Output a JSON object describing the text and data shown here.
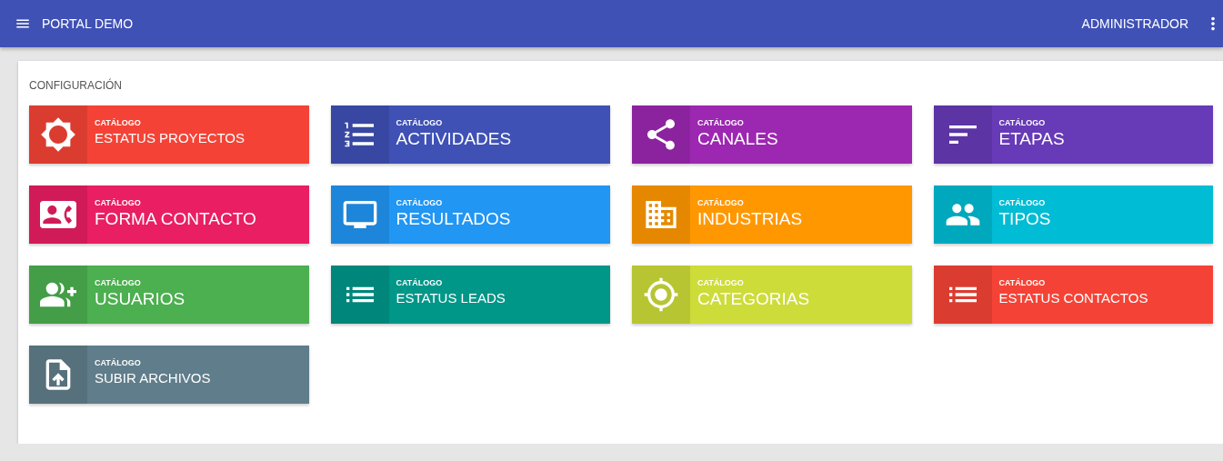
{
  "app_bar": {
    "title": "PORTAL DEMO",
    "user": "ADMINISTRADOR"
  },
  "section": {
    "title": "CONFIGURACIÓN"
  },
  "tiles": [
    {
      "caption": "CATÁLOGO",
      "title": "ESTATUS PROYECTOS",
      "color": "#f44336"
    },
    {
      "caption": "CATÁLOGO",
      "title": "ACTIVIDADES",
      "color": "#3f51b5"
    },
    {
      "caption": "CATÁLOGO",
      "title": "CANALES",
      "color": "#9c27b0"
    },
    {
      "caption": "CATÁLOGO",
      "title": "ETAPAS",
      "color": "#673ab7"
    },
    {
      "caption": "CATÁLOGO",
      "title": "FORMA CONTACTO",
      "color": "#e91e63"
    },
    {
      "caption": "CATÁLOGO",
      "title": "RESULTADOS",
      "color": "#2196f3"
    },
    {
      "caption": "CATÁLOGO",
      "title": "INDUSTRIAS",
      "color": "#ff9800"
    },
    {
      "caption": "CATÁLOGO",
      "title": "TIPOS",
      "color": "#00bcd4"
    },
    {
      "caption": "CATÁLOGO",
      "title": "USUARIOS",
      "color": "#4caf50"
    },
    {
      "caption": "CATÁLOGO",
      "title": "ESTATUS LEADS",
      "color": "#009688"
    },
    {
      "caption": "CATÁLOGO",
      "title": "CATEGORIAS",
      "color": "#cddc39"
    },
    {
      "caption": "CATÁLOGO",
      "title": "ESTATUS CONTACTOS",
      "color": "#f44336"
    },
    {
      "caption": "CATÁLOGO",
      "title": "SUBIR ARCHIVOS",
      "color": "#607d8b"
    }
  ]
}
